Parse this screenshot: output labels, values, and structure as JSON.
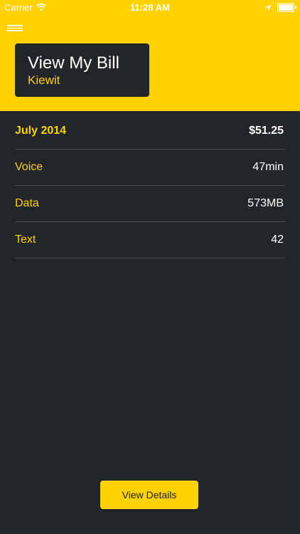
{
  "status_bar": {
    "carrier": "Carrier",
    "time": "11:28 AM",
    "icons": [
      "wifi-icon",
      "location-arrow-icon",
      "battery-icon"
    ]
  },
  "header": {
    "menu_icon": "hamburger-icon",
    "title": "View My Bill",
    "subtitle": "Kiewit"
  },
  "bill": {
    "period": {
      "label": "July 2014",
      "value": "$51.25"
    },
    "rows": [
      {
        "label": "Voice",
        "value": "47min"
      },
      {
        "label": "Data",
        "value": "573MB"
      },
      {
        "label": "Text",
        "value": "42"
      }
    ]
  },
  "actions": {
    "view_details_label": "View Details"
  },
  "colors": {
    "accent": "#ffd200",
    "background": "#232629",
    "divider": "#4a4d50",
    "text": "#ffffff"
  }
}
